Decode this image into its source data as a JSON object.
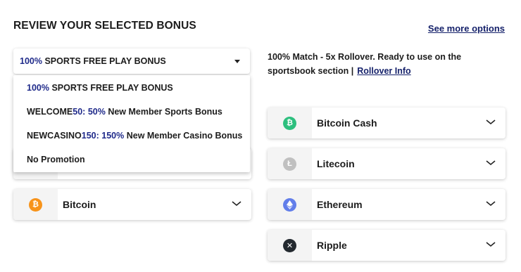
{
  "header": {
    "title": "REVIEW YOUR SELECTED BONUS",
    "see_more": "See more options"
  },
  "bonus_select": {
    "selected_highlight": "100%",
    "selected_rest": " SPORTS FREE PLAY BONUS"
  },
  "description": {
    "line1": "100% Match - 5x Rollover. Ready to use on the",
    "line2": "sportsbook section |",
    "rollover_link": "Rollover Info"
  },
  "dropdown": {
    "items": [
      {
        "a": "",
        "b": "100%",
        "c": " SPORTS FREE PLAY BONUS"
      },
      {
        "a": "WELCOME",
        "b": "50: 50%",
        "c": " New Member Sports Bonus"
      },
      {
        "a": "NEWCASINO",
        "b": "150: 150%",
        "c": " New Member Casino Bonus"
      },
      {
        "a": "No Promotion",
        "b": "",
        "c": ""
      }
    ]
  },
  "payment_methods": {
    "left": [
      {
        "name": "Bitcoin",
        "icon": "bitcoin-icon",
        "color": "#f7931a"
      }
    ],
    "right": [
      {
        "name": "Bitcoin Cash",
        "icon": "bitcoin-cash-icon",
        "color": "#2dbf7e"
      },
      {
        "name": "Litecoin",
        "icon": "litecoin-icon",
        "color": "#c0c0c0"
      },
      {
        "name": "Ethereum",
        "icon": "ethereum-icon",
        "color": "#627eea"
      },
      {
        "name": "Ripple",
        "icon": "ripple-icon",
        "color": "#23292f"
      }
    ]
  },
  "colors": {
    "accent": "#1f2a8a",
    "link": "#16226b"
  }
}
